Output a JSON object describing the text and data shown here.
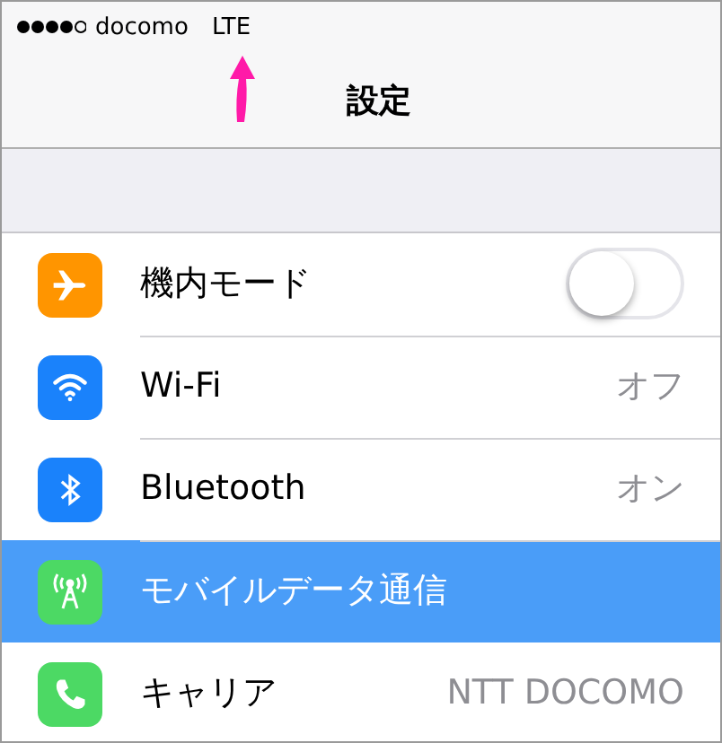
{
  "status_bar": {
    "carrier": "docomo",
    "network": "LTE"
  },
  "nav_bar": {
    "title": "設定"
  },
  "rows": [
    {
      "label": "機内モード",
      "color": "#ff9500",
      "kind": "toggle",
      "on": false,
      "selected": false
    },
    {
      "label": "Wi-Fi",
      "color": "#1a82fb",
      "kind": "value",
      "value": "オフ",
      "selected": false
    },
    {
      "label": "Bluetooth",
      "color": "#1a82fb",
      "kind": "value",
      "value": "オン",
      "selected": false
    },
    {
      "label": "モバイルデータ通信",
      "color": "#4cd964",
      "kind": "plain",
      "selected": true
    },
    {
      "label": "キャリア",
      "color": "#4cd964",
      "kind": "value",
      "value": "NTT DOCOMO",
      "selected": false
    }
  ]
}
